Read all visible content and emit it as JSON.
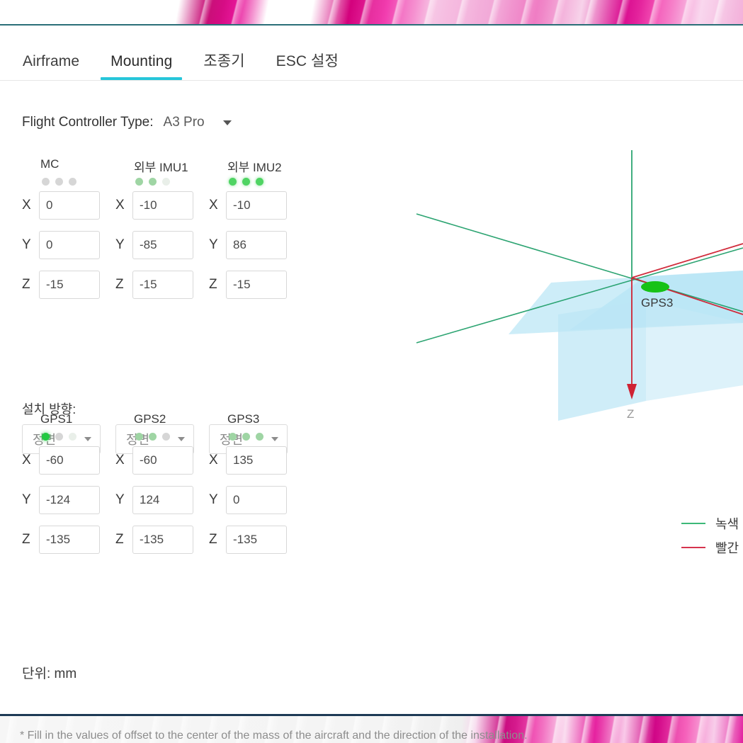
{
  "tabs": [
    {
      "label": "Airframe",
      "active": false
    },
    {
      "label": "Mounting",
      "active": true
    },
    {
      "label": "조종기",
      "active": false
    },
    {
      "label": "ESC 설정",
      "active": false
    }
  ],
  "fc_type": {
    "label": "Flight Controller Type:",
    "value": "A3 Pro"
  },
  "sensor_groups": {
    "imu": [
      {
        "title": "MC",
        "dots": [
          "off",
          "off",
          "off"
        ],
        "fields": [
          {
            "axis": "X",
            "value": "0"
          },
          {
            "axis": "Y",
            "value": "0"
          },
          {
            "axis": "Z",
            "value": "-15"
          }
        ],
        "direction": "정면"
      },
      {
        "title": "외부 IMU1",
        "dots": [
          "dim",
          "dim",
          "faint"
        ],
        "fields": [
          {
            "axis": "X",
            "value": "-10"
          },
          {
            "axis": "Y",
            "value": "-85"
          },
          {
            "axis": "Z",
            "value": "-15"
          }
        ],
        "direction": "정면"
      },
      {
        "title": "외부 IMU2",
        "dots": [
          "on",
          "on",
          "on"
        ],
        "fields": [
          {
            "axis": "X",
            "value": "-10"
          },
          {
            "axis": "Y",
            "value": "86"
          },
          {
            "axis": "Z",
            "value": "-15"
          }
        ],
        "direction": "정면"
      }
    ],
    "gps": [
      {
        "title": "GPS1",
        "dots": [
          "bright",
          "off",
          "faint"
        ],
        "fields": [
          {
            "axis": "X",
            "value": "-60"
          },
          {
            "axis": "Y",
            "value": "-124"
          },
          {
            "axis": "Z",
            "value": "-135"
          }
        ]
      },
      {
        "title": "GPS2",
        "dots": [
          "dim",
          "dim",
          "off"
        ],
        "fields": [
          {
            "axis": "X",
            "value": "-60"
          },
          {
            "axis": "Y",
            "value": "124"
          },
          {
            "axis": "Z",
            "value": "-135"
          }
        ]
      },
      {
        "title": "GPS3",
        "dots": [
          "dim",
          "dim",
          "dim"
        ],
        "fields": [
          {
            "axis": "X",
            "value": "135"
          },
          {
            "axis": "Y",
            "value": "0"
          },
          {
            "axis": "Z",
            "value": "-135"
          }
        ]
      }
    ]
  },
  "direction_label": "설치 방향:",
  "unit_text": "단위: mm",
  "footnote": "* Fill in the values of offset to the center of the mass of the aircraft and the direction of the installation.",
  "viewport": {
    "gps_marker_label": "GPS3",
    "z_axis_label": "Z"
  },
  "legend": [
    {
      "color": "#3cb878",
      "label": "녹색"
    },
    {
      "color": "#d6344e",
      "label": "빨간"
    }
  ],
  "colors": {
    "accent_tab": "#26c6da",
    "axis_green": "#22a06b",
    "axis_red": "#cf2233",
    "plane_blue": "#a8dff0",
    "gps_marker_green": "#17c217",
    "top_divider": "#2a6f78",
    "bottom_divider": "#1d3a55"
  }
}
